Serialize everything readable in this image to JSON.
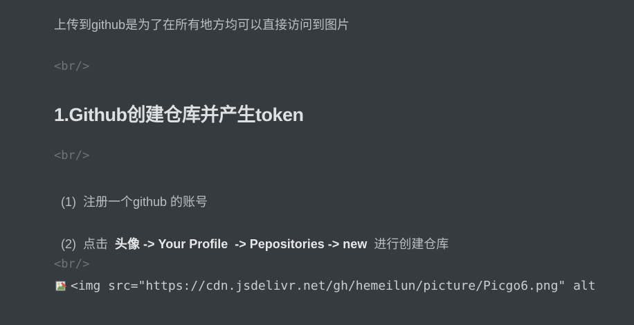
{
  "document": {
    "intro": "上传到github是为了在所有地方均可以直接访问到图片",
    "br_tag": "<br/>",
    "heading": "1.Github创建仓库并产生token",
    "step1": {
      "prefix": "(1)",
      "text": "注册一个github 的账号"
    },
    "step2": {
      "prefix": "(2)",
      "text_before": "点击",
      "bold_1": "头像 -> Your Profile",
      "arrow": "->",
      "bold_2": "Pepositories -> new",
      "text_after": "进行创建仓库"
    },
    "img_source": "<img src=\"https://cdn.jsdelivr.net/gh/hemeilun/picture/Picgo6.png\" alt"
  },
  "icons": {
    "broken_image": "broken-image-icon"
  }
}
